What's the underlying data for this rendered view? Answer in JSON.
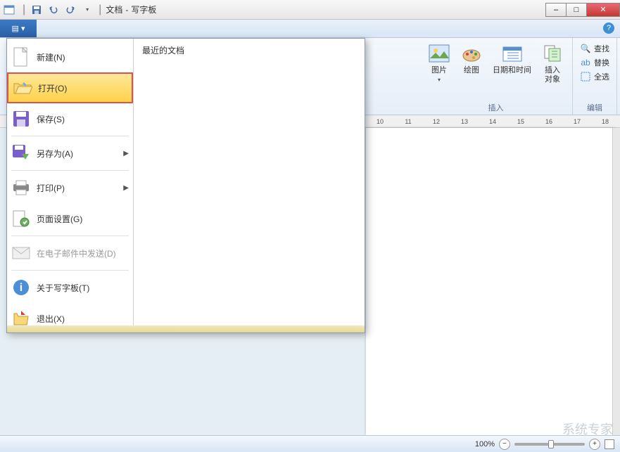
{
  "title": {
    "doc": "文档",
    "app": "写字板",
    "separator": "-"
  },
  "qat": {
    "save": "save",
    "undo": "undo",
    "redo": "redo"
  },
  "win": {
    "min": "–",
    "max": "□",
    "close": "✕"
  },
  "help": "?",
  "ribbon": {
    "insert": {
      "label": "插入",
      "buttons": {
        "picture": "图片",
        "paint": "绘图",
        "datetime": "日期和时间",
        "object": "插入\n对象"
      }
    },
    "edit": {
      "label": "编辑",
      "items": {
        "find": "查找",
        "replace": "替换",
        "selectall": "全选"
      }
    }
  },
  "file_menu": {
    "recent_title": "最近的文档",
    "items": {
      "new": "新建(N)",
      "open": "打开(O)",
      "save": "保存(S)",
      "saveas": "另存为(A)",
      "print": "打印(P)",
      "pagesetup": "页面设置(G)",
      "email": "在电子邮件中发送(D)",
      "about": "关于写字板(T)",
      "exit": "退出(X)"
    }
  },
  "ruler": {
    "ticks": [
      "10",
      "11",
      "12",
      "13",
      "14",
      "15",
      "16",
      "17",
      "18"
    ]
  },
  "status": {
    "zoom": "100%"
  },
  "watermark": "系统专家"
}
